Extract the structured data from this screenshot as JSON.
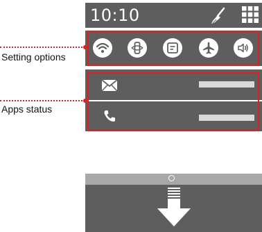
{
  "status_bar": {
    "time": "10:10"
  },
  "settings": {
    "buttons": [
      {
        "icon": "wifi-icon"
      },
      {
        "icon": "rotate-lock-icon"
      },
      {
        "icon": "screen-icon"
      },
      {
        "icon": "airplane-icon"
      },
      {
        "icon": "sound-icon"
      }
    ]
  },
  "apps": {
    "items": [
      {
        "icon": "mail-icon"
      },
      {
        "icon": "phone-icon"
      }
    ]
  },
  "callouts": {
    "settings_label": "Setting options",
    "apps_label": "Apps status"
  },
  "colors": {
    "panel": "#5e5e5e",
    "highlight": "#e02020",
    "drawer_top": "#a8a8a8"
  }
}
